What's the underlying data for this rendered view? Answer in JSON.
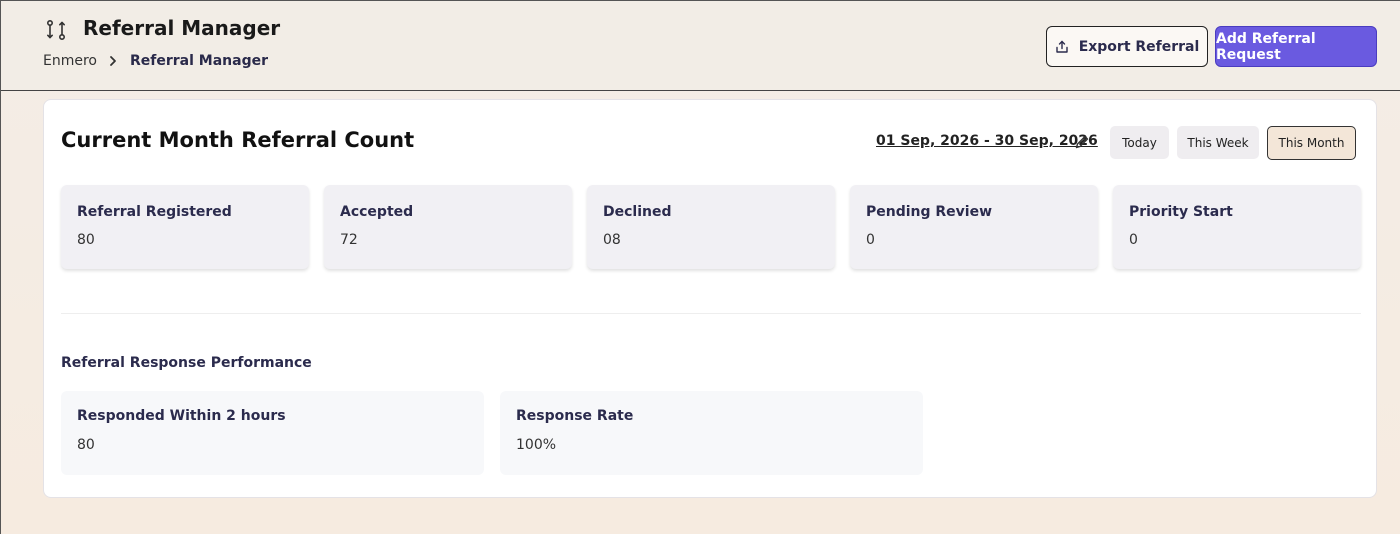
{
  "header": {
    "title": "Referral Manager",
    "breadcrumb": {
      "root": "Enmero",
      "current": "Referral Manager"
    },
    "export_label": "Export Referral",
    "add_label": "Add Referral Request"
  },
  "card": {
    "title": "Current Month Referral Count",
    "date_range": "01 Sep, 2026 - 30 Sep, 2026",
    "filters": {
      "today": "Today",
      "week": "This Week",
      "month": "This Month"
    },
    "active_filter": "This Month",
    "stats": [
      {
        "label": "Referral Registered",
        "value": "80"
      },
      {
        "label": "Accepted",
        "value": "72"
      },
      {
        "label": "Declined",
        "value": "08"
      },
      {
        "label": "Pending Review",
        "value": "0"
      },
      {
        "label": "Priority Start",
        "value": "0"
      }
    ],
    "performance": {
      "title": "Referral Response Performance",
      "items": [
        {
          "label": "Responded Within 2 hours",
          "value": "80"
        },
        {
          "label": "Response Rate",
          "value": "100%"
        }
      ]
    }
  },
  "colors": {
    "accent": "#6a5ae0",
    "active_filter_bg": "#f3e6d8",
    "page_bg": "#f3ede6"
  },
  "icons": [
    "referral-flow-icon",
    "chevron-right-icon",
    "share-export-icon",
    "pencil-edit-icon"
  ]
}
